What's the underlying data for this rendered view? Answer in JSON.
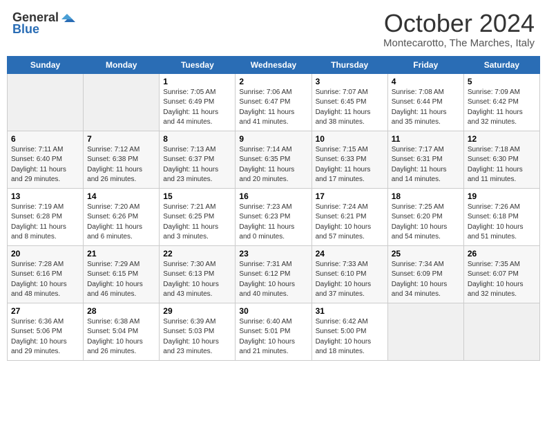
{
  "header": {
    "logo_general": "General",
    "logo_blue": "Blue",
    "title": "October 2024",
    "subtitle": "Montecarotto, The Marches, Italy"
  },
  "weekdays": [
    "Sunday",
    "Monday",
    "Tuesday",
    "Wednesday",
    "Thursday",
    "Friday",
    "Saturday"
  ],
  "weeks": [
    [
      {
        "day": "",
        "info": ""
      },
      {
        "day": "",
        "info": ""
      },
      {
        "day": "1",
        "info": "Sunrise: 7:05 AM\nSunset: 6:49 PM\nDaylight: 11 hours and 44 minutes."
      },
      {
        "day": "2",
        "info": "Sunrise: 7:06 AM\nSunset: 6:47 PM\nDaylight: 11 hours and 41 minutes."
      },
      {
        "day": "3",
        "info": "Sunrise: 7:07 AM\nSunset: 6:45 PM\nDaylight: 11 hours and 38 minutes."
      },
      {
        "day": "4",
        "info": "Sunrise: 7:08 AM\nSunset: 6:44 PM\nDaylight: 11 hours and 35 minutes."
      },
      {
        "day": "5",
        "info": "Sunrise: 7:09 AM\nSunset: 6:42 PM\nDaylight: 11 hours and 32 minutes."
      }
    ],
    [
      {
        "day": "6",
        "info": "Sunrise: 7:11 AM\nSunset: 6:40 PM\nDaylight: 11 hours and 29 minutes."
      },
      {
        "day": "7",
        "info": "Sunrise: 7:12 AM\nSunset: 6:38 PM\nDaylight: 11 hours and 26 minutes."
      },
      {
        "day": "8",
        "info": "Sunrise: 7:13 AM\nSunset: 6:37 PM\nDaylight: 11 hours and 23 minutes."
      },
      {
        "day": "9",
        "info": "Sunrise: 7:14 AM\nSunset: 6:35 PM\nDaylight: 11 hours and 20 minutes."
      },
      {
        "day": "10",
        "info": "Sunrise: 7:15 AM\nSunset: 6:33 PM\nDaylight: 11 hours and 17 minutes."
      },
      {
        "day": "11",
        "info": "Sunrise: 7:17 AM\nSunset: 6:31 PM\nDaylight: 11 hours and 14 minutes."
      },
      {
        "day": "12",
        "info": "Sunrise: 7:18 AM\nSunset: 6:30 PM\nDaylight: 11 hours and 11 minutes."
      }
    ],
    [
      {
        "day": "13",
        "info": "Sunrise: 7:19 AM\nSunset: 6:28 PM\nDaylight: 11 hours and 8 minutes."
      },
      {
        "day": "14",
        "info": "Sunrise: 7:20 AM\nSunset: 6:26 PM\nDaylight: 11 hours and 6 minutes."
      },
      {
        "day": "15",
        "info": "Sunrise: 7:21 AM\nSunset: 6:25 PM\nDaylight: 11 hours and 3 minutes."
      },
      {
        "day": "16",
        "info": "Sunrise: 7:23 AM\nSunset: 6:23 PM\nDaylight: 11 hours and 0 minutes."
      },
      {
        "day": "17",
        "info": "Sunrise: 7:24 AM\nSunset: 6:21 PM\nDaylight: 10 hours and 57 minutes."
      },
      {
        "day": "18",
        "info": "Sunrise: 7:25 AM\nSunset: 6:20 PM\nDaylight: 10 hours and 54 minutes."
      },
      {
        "day": "19",
        "info": "Sunrise: 7:26 AM\nSunset: 6:18 PM\nDaylight: 10 hours and 51 minutes."
      }
    ],
    [
      {
        "day": "20",
        "info": "Sunrise: 7:28 AM\nSunset: 6:16 PM\nDaylight: 10 hours and 48 minutes."
      },
      {
        "day": "21",
        "info": "Sunrise: 7:29 AM\nSunset: 6:15 PM\nDaylight: 10 hours and 46 minutes."
      },
      {
        "day": "22",
        "info": "Sunrise: 7:30 AM\nSunset: 6:13 PM\nDaylight: 10 hours and 43 minutes."
      },
      {
        "day": "23",
        "info": "Sunrise: 7:31 AM\nSunset: 6:12 PM\nDaylight: 10 hours and 40 minutes."
      },
      {
        "day": "24",
        "info": "Sunrise: 7:33 AM\nSunset: 6:10 PM\nDaylight: 10 hours and 37 minutes."
      },
      {
        "day": "25",
        "info": "Sunrise: 7:34 AM\nSunset: 6:09 PM\nDaylight: 10 hours and 34 minutes."
      },
      {
        "day": "26",
        "info": "Sunrise: 7:35 AM\nSunset: 6:07 PM\nDaylight: 10 hours and 32 minutes."
      }
    ],
    [
      {
        "day": "27",
        "info": "Sunrise: 6:36 AM\nSunset: 5:06 PM\nDaylight: 10 hours and 29 minutes."
      },
      {
        "day": "28",
        "info": "Sunrise: 6:38 AM\nSunset: 5:04 PM\nDaylight: 10 hours and 26 minutes."
      },
      {
        "day": "29",
        "info": "Sunrise: 6:39 AM\nSunset: 5:03 PM\nDaylight: 10 hours and 23 minutes."
      },
      {
        "day": "30",
        "info": "Sunrise: 6:40 AM\nSunset: 5:01 PM\nDaylight: 10 hours and 21 minutes."
      },
      {
        "day": "31",
        "info": "Sunrise: 6:42 AM\nSunset: 5:00 PM\nDaylight: 10 hours and 18 minutes."
      },
      {
        "day": "",
        "info": ""
      },
      {
        "day": "",
        "info": ""
      }
    ]
  ]
}
